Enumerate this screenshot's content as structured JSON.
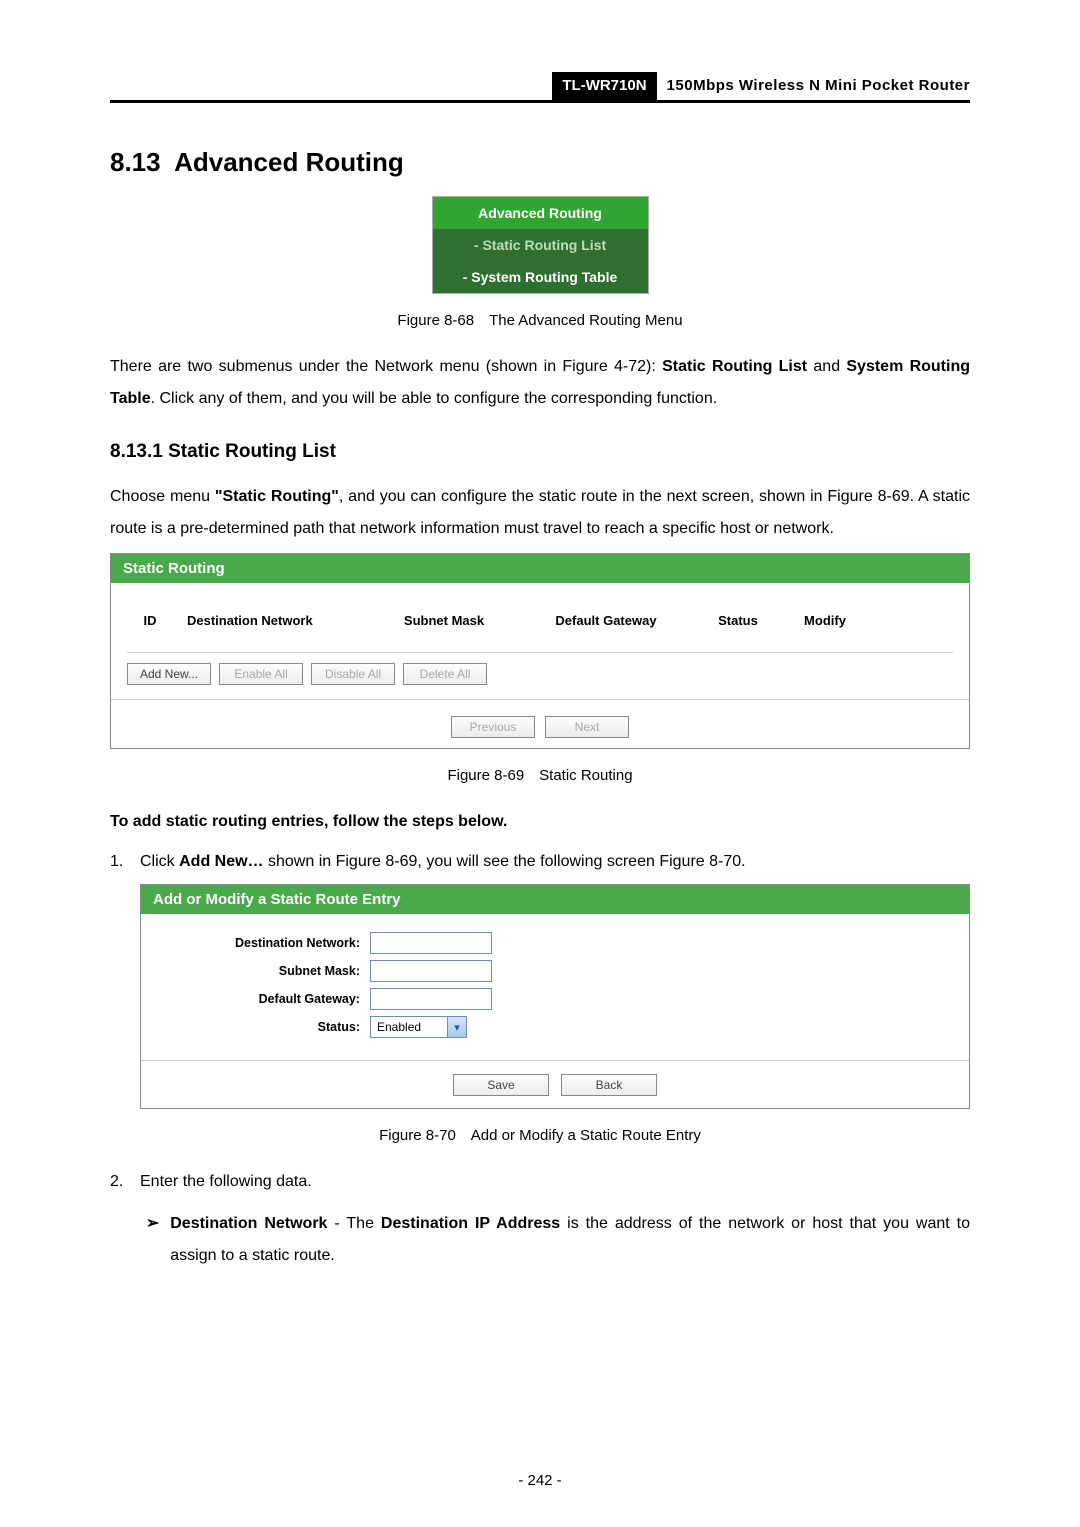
{
  "header": {
    "model": "TL-WR710N",
    "product_desc": "150Mbps Wireless N Mini Pocket Router"
  },
  "section": {
    "number": "8.13",
    "title": "Advanced Routing"
  },
  "figure68": {
    "menu_header": "Advanced Routing",
    "item1": "- Static Routing List",
    "item2": "- System Routing Table",
    "caption": "Figure 8-68 The Advanced Routing Menu"
  },
  "para1": {
    "part1": "There are two submenus under the Network menu (shown in Figure 4-72): ",
    "bold1": "Static Routing List",
    "part2": " and ",
    "bold2": "System Routing Table",
    "part3": ". Click any of them, and you will be able to configure the corresponding function."
  },
  "subsection": {
    "number": "8.13.1",
    "title": "Static Routing List"
  },
  "para2": {
    "part1": "Choose menu ",
    "bold1": "\"Static Routing\"",
    "part2": ", and you can configure the static route in the next screen, shown in Figure 8-69. A static route is a pre-determined path that network information must travel to reach a specific host or network."
  },
  "figure69": {
    "title": "Static Routing",
    "col_id": "ID",
    "col_dest": "Destination Network",
    "col_mask": "Subnet Mask",
    "col_gw": "Default Gateway",
    "col_status": "Status",
    "col_modify": "Modify",
    "btn_add": "Add New...",
    "btn_enable": "Enable All",
    "btn_disable": "Disable All",
    "btn_delete": "Delete All",
    "btn_prev": "Previous",
    "btn_next": "Next",
    "caption": "Figure 8-69 Static Routing"
  },
  "para3": "To add static routing entries, follow the steps below.",
  "step1": {
    "num": "1.",
    "part1": "Click ",
    "bold1": "Add New…",
    "part2": " shown in Figure 8-69, you will see the following screen Figure 8-70."
  },
  "figure70": {
    "title": "Add or Modify a Static Route Entry",
    "label_dest": "Destination Network:",
    "label_mask": "Subnet Mask:",
    "label_gw": "Default Gateway:",
    "label_status": "Status:",
    "status_value": "Enabled",
    "btn_save": "Save",
    "btn_back": "Back",
    "caption": "Figure 8-70 Add or Modify a Static Route Entry"
  },
  "step2": {
    "num": "2.",
    "text": "Enter the following data."
  },
  "bullet1": {
    "arrow": "➢",
    "bold1": "Destination Network",
    "dash": " - The ",
    "bold2": "Destination IP Address",
    "tail": " is the address of the network or host that you want to assign to a static route."
  },
  "page_number": "- 242 -"
}
